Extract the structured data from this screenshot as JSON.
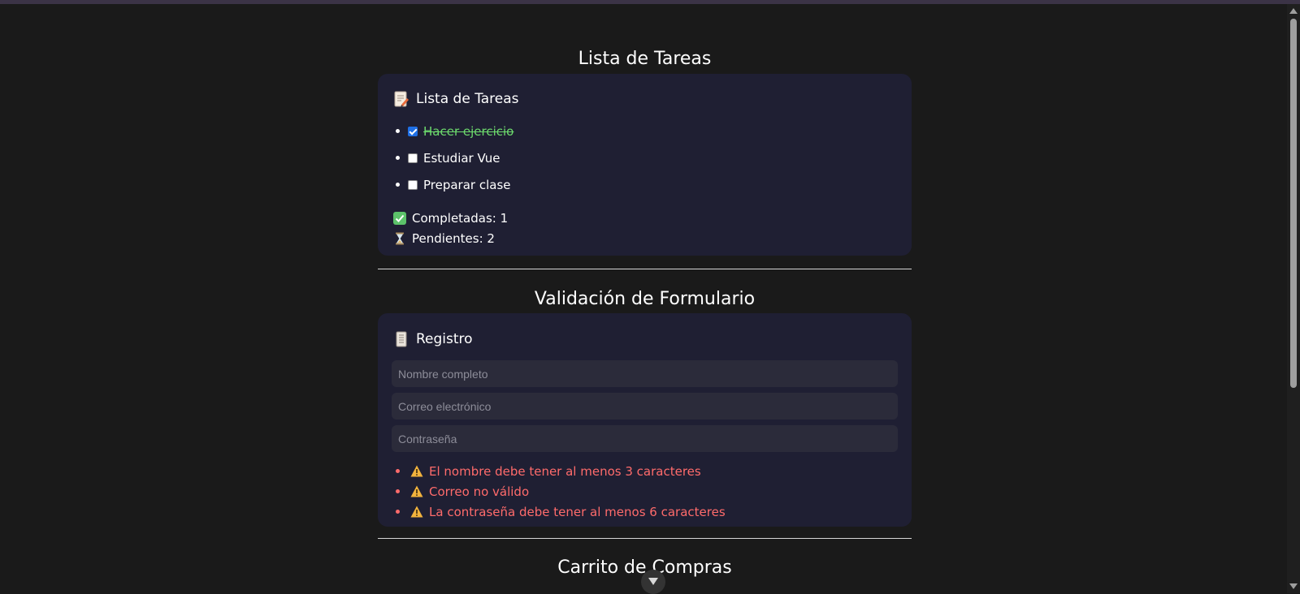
{
  "sections": {
    "tasks_heading": "Lista de Tareas",
    "form_heading": "Validación de Formulario",
    "cart_heading": "Carrito de Compras"
  },
  "task_card": {
    "title": "Lista de Tareas",
    "tasks": [
      {
        "label": "Hacer ejercicio",
        "done": true
      },
      {
        "label": "Estudiar Vue",
        "done": false
      },
      {
        "label": "Preparar clase",
        "done": false
      }
    ],
    "completed_text": "Completadas: 1",
    "pending_text": "Pendientes: 2"
  },
  "form_card": {
    "title": "Registro",
    "name_placeholder": "Nombre completo",
    "email_placeholder": "Correo electrónico",
    "password_placeholder": "Contraseña",
    "errors": [
      "El nombre debe tener al menos 3 caracteres",
      "Correo no válido",
      "La contraseña debe tener al menos 6 caracteres"
    ]
  },
  "icons": {
    "task_title_icon": "memo-icon",
    "form_title_icon": "scroll-icon",
    "completed_icon": "check-mark-icon",
    "pending_icon": "hourglass-icon",
    "error_icon": "warning-icon",
    "scroll_down_icon": "chevron-down-icon"
  },
  "colors": {
    "background": "#1a1a1a",
    "card": "#1f1f33",
    "done_text": "#6ddb6d",
    "error_text": "#ff6b6b",
    "checkbox_checked": "#1f6fe5"
  }
}
